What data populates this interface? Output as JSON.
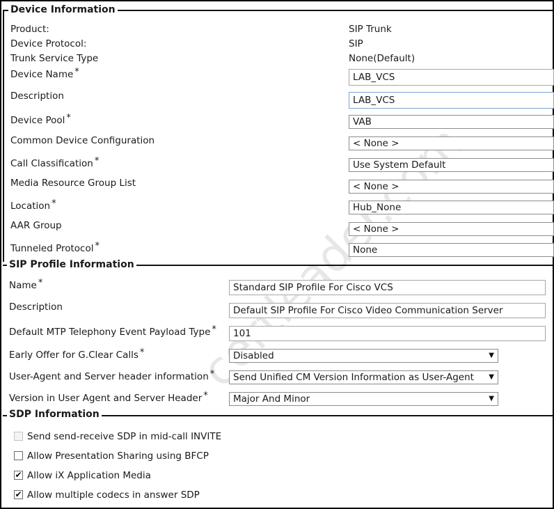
{
  "device_info": {
    "title": "Device Information",
    "product_label": "Product:",
    "product_value": "SIP Trunk",
    "protocol_label": "Device Protocol:",
    "protocol_value": "SIP",
    "trunk_service_label": "Trunk Service Type",
    "trunk_service_value": "None(Default)",
    "device_name_label": "Device Name",
    "device_name_value": "LAB_VCS",
    "description_label": "Description",
    "description_value": "LAB_VCS",
    "device_pool_label": "Device Pool",
    "device_pool_value": "VAB",
    "common_config_label": "Common Device Configuration",
    "common_config_value": "< None >",
    "call_class_label": "Call Classification",
    "call_class_value": "Use System Default",
    "mrgl_label": "Media Resource Group List",
    "mrgl_value": "< None >",
    "location_label": "Location",
    "location_value": "Hub_None",
    "aar_label": "AAR Group",
    "aar_value": "< None >",
    "tunneled_label": "Tunneled Protocol",
    "tunneled_value": "None"
  },
  "sip_profile": {
    "title": "SIP Profile Information",
    "name_label": "Name",
    "name_value": "Standard SIP Profile For Cisco VCS",
    "description_label": "Description",
    "description_value": "Default SIP Profile For Cisco Video Communication Server",
    "mtp_label": "Default MTP Telephony Event Payload Type",
    "mtp_value": "101",
    "early_offer_label": "Early Offer for G.Clear Calls",
    "early_offer_value": "Disabled",
    "user_agent_label": "User-Agent and Server header information",
    "user_agent_value": "Send Unified CM Version Information as User-Agent",
    "version_label": "Version in User Agent and Server Header",
    "version_value": "Major And Minor"
  },
  "sdp_info": {
    "title": "SDP Information",
    "send_receive_label": "Send send-receive SDP in mid-call INVITE",
    "bfcp_label": "Allow Presentation Sharing using BFCP",
    "ix_label": "Allow iX Application Media",
    "multi_codec_label": "Allow multiple codecs in answer SDP",
    "send_receive_checked": false,
    "bfcp_checked": false,
    "ix_checked": true,
    "multi_codec_checked": true
  },
  "required_marker": "*",
  "dropdown_arrow": "▼",
  "check_mark": "✔",
  "watermark": "certleader.com"
}
